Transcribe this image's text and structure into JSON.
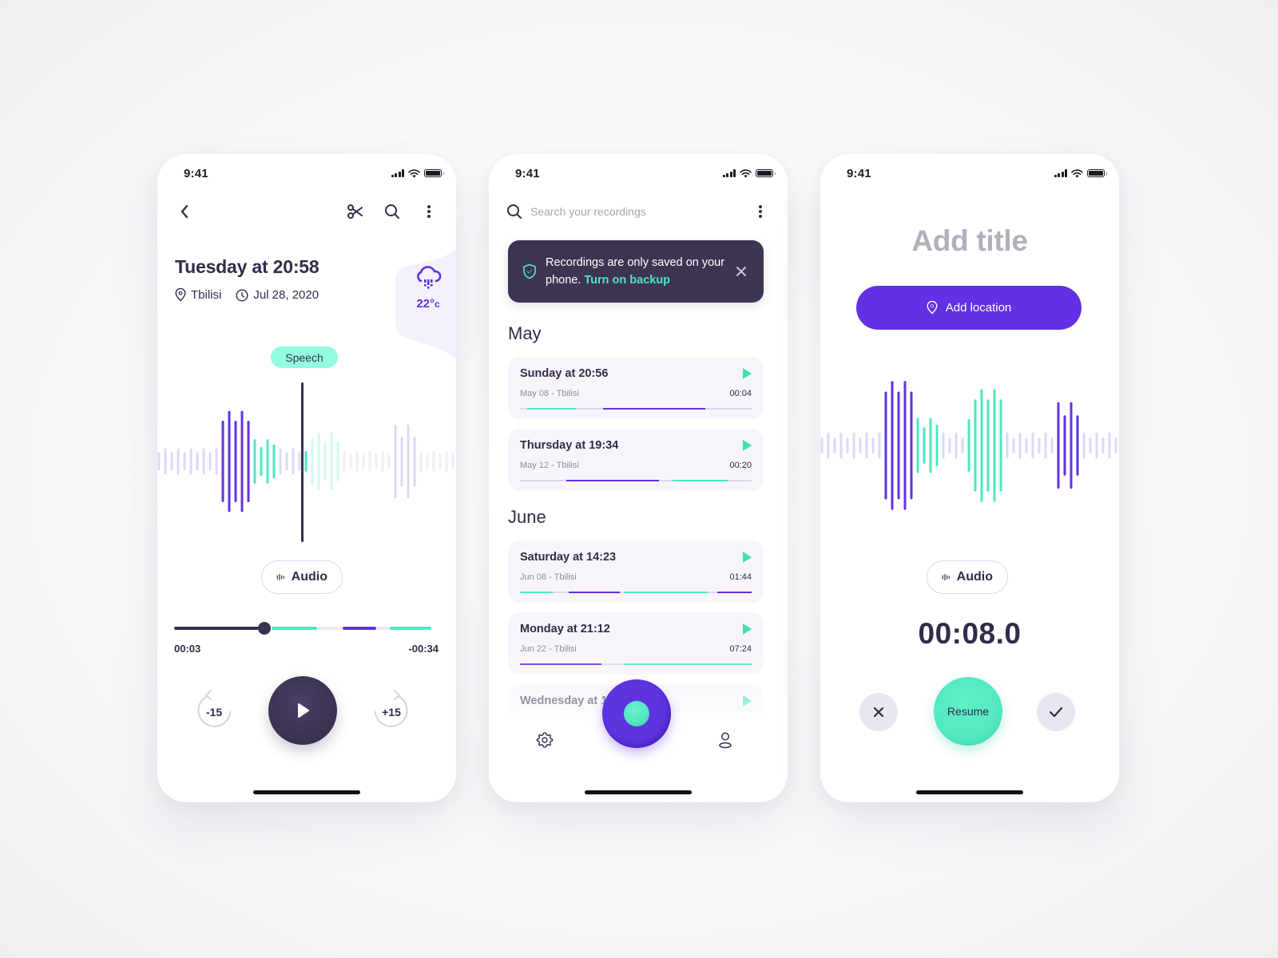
{
  "colors": {
    "purple": "#6231e3",
    "mint": "#4fe6c0",
    "dark": "#3b3150",
    "muted_purple": "#dcd8f4",
    "muted_mint": "#d6f9ef"
  },
  "status_bar": {
    "time": "9:41",
    "icons": [
      "cellular-signal-icon",
      "wifi-icon",
      "battery-icon"
    ]
  },
  "player": {
    "nav": {
      "back_icon": "chevron-left-icon",
      "actions": [
        "scissors-icon",
        "search-icon",
        "more-vertical-icon"
      ]
    },
    "title": "Tuesday at 20:58",
    "location": "Tbilisi",
    "date": "Jul 28, 2020",
    "weather": {
      "icon": "cloud-rain-icon",
      "temperature": "22°",
      "unit": "c"
    },
    "tag": "Speech",
    "waveform": {
      "bars": [
        {
          "h": 0.12,
          "c": "p"
        },
        {
          "h": 0.18,
          "c": "p"
        },
        {
          "h": 0.12,
          "c": "p"
        },
        {
          "h": 0.18,
          "c": "p"
        },
        {
          "h": 0.12,
          "c": "p"
        },
        {
          "h": 0.18,
          "c": "p"
        },
        {
          "h": 0.12,
          "c": "p"
        },
        {
          "h": 0.18,
          "c": "p"
        },
        {
          "h": 0.12,
          "c": "p"
        },
        {
          "h": 0.18,
          "c": "p"
        },
        {
          "h": 0.6,
          "c": "P"
        },
        {
          "h": 0.75,
          "c": "P"
        },
        {
          "h": 0.6,
          "c": "P"
        },
        {
          "h": 0.75,
          "c": "P"
        },
        {
          "h": 0.6,
          "c": "P"
        },
        {
          "h": 0.32,
          "c": "M"
        },
        {
          "h": 0.2,
          "c": "M"
        },
        {
          "h": 0.32,
          "c": "M"
        },
        {
          "h": 0.24,
          "c": "M"
        },
        {
          "h": 0.18,
          "c": "p"
        },
        {
          "h": 0.12,
          "c": "p"
        },
        {
          "h": 0.18,
          "c": "p"
        },
        {
          "h": 0.12,
          "c": "p"
        },
        {
          "h": 0.14,
          "c": "M"
        },
        {
          "h": 0.34,
          "c": "m"
        },
        {
          "h": 0.42,
          "c": "m"
        },
        {
          "h": 0.28,
          "c": "m"
        },
        {
          "h": 0.42,
          "c": "m"
        },
        {
          "h": 0.28,
          "c": "m"
        },
        {
          "h": 0.14,
          "c": "q"
        },
        {
          "h": 0.1,
          "c": "q"
        },
        {
          "h": 0.14,
          "c": "q"
        },
        {
          "h": 0.1,
          "c": "q"
        },
        {
          "h": 0.14,
          "c": "q"
        },
        {
          "h": 0.1,
          "c": "q"
        },
        {
          "h": 0.14,
          "c": "q"
        },
        {
          "h": 0.1,
          "c": "q"
        },
        {
          "h": 0.54,
          "c": "p"
        },
        {
          "h": 0.36,
          "c": "p"
        },
        {
          "h": 0.54,
          "c": "p"
        },
        {
          "h": 0.36,
          "c": "p"
        },
        {
          "h": 0.14,
          "c": "q"
        },
        {
          "h": 0.1,
          "c": "q"
        },
        {
          "h": 0.14,
          "c": "q"
        },
        {
          "h": 0.1,
          "c": "q"
        },
        {
          "h": 0.14,
          "c": "q"
        },
        {
          "h": 0.1,
          "c": "q"
        }
      ]
    },
    "view_toggle": {
      "icon": "audio-waveform-icon",
      "label": "Audio"
    },
    "progress": {
      "position_fraction": 0.35,
      "segments": [
        {
          "from": 0.0,
          "to": 0.35,
          "color": "dark"
        },
        {
          "from": 0.38,
          "to": 0.555,
          "color": "mint"
        },
        {
          "from": 0.555,
          "to": 0.655,
          "color": "track"
        },
        {
          "from": 0.655,
          "to": 0.785,
          "color": "purple"
        },
        {
          "from": 0.785,
          "to": 0.84,
          "color": "track"
        },
        {
          "from": 0.84,
          "to": 1.0,
          "color": "mint"
        }
      ]
    },
    "elapsed": "00:03",
    "remaining": "-00:34",
    "rewind_label": "-15",
    "forward_label": "+15",
    "play_icon": "play-icon"
  },
  "list": {
    "search_placeholder": "Search your recordings",
    "search_value": "",
    "banner": {
      "icon": "shield-check-icon",
      "text": "Recordings are only saved on your phone.",
      "link": "Turn on backup",
      "close_icon": "close-icon"
    },
    "groups": [
      {
        "month": "May",
        "items": [
          {
            "title": "Sunday at 20:56",
            "subtitle": "May 08 - Tbilisi",
            "duration": "00:04",
            "segments": [
              {
                "from": 0.03,
                "to": 0.24,
                "color": "mint"
              },
              {
                "from": 0.36,
                "to": 0.8,
                "color": "purple"
              }
            ]
          },
          {
            "title": "Thursday at 19:34",
            "subtitle": "May 12 - Tbilisi",
            "duration": "00:20",
            "segments": [
              {
                "from": 0.2,
                "to": 0.6,
                "color": "purple"
              },
              {
                "from": 0.66,
                "to": 0.9,
                "color": "mint"
              }
            ]
          }
        ]
      },
      {
        "month": "June",
        "items": [
          {
            "title": "Saturday at 14:23",
            "subtitle": "Jun 08 - Tbilisi",
            "duration": "01:44",
            "segments": [
              {
                "from": 0.0,
                "to": 0.14,
                "color": "mint"
              },
              {
                "from": 0.21,
                "to": 0.43,
                "color": "purple"
              },
              {
                "from": 0.45,
                "to": 0.81,
                "color": "mint"
              },
              {
                "from": 0.85,
                "to": 1.0,
                "color": "purple"
              }
            ]
          },
          {
            "title": "Monday at 21:12",
            "subtitle": "Jun 22 - Tbilisi",
            "duration": "07:24",
            "segments": [
              {
                "from": 0.0,
                "to": 0.35,
                "color": "purple"
              },
              {
                "from": 0.45,
                "to": 1.0,
                "color": "mint"
              }
            ]
          },
          {
            "title": "Wednesday at 1",
            "subtitle": "",
            "duration": "",
            "segments": []
          }
        ]
      }
    ],
    "bottom_nav": {
      "left_icon": "settings-gear-icon",
      "center": "record-button",
      "right_icon": "user-profile-icon"
    }
  },
  "record": {
    "title_placeholder": "Add title",
    "add_location_label": "Add location",
    "location_icon": "map-pin-icon",
    "waveform": {
      "bars": [
        {
          "h": 0.1,
          "c": "p"
        },
        {
          "h": 0.18,
          "c": "p"
        },
        {
          "h": 0.1,
          "c": "p"
        },
        {
          "h": 0.18,
          "c": "p"
        },
        {
          "h": 0.1,
          "c": "p"
        },
        {
          "h": 0.18,
          "c": "p"
        },
        {
          "h": 0.1,
          "c": "p"
        },
        {
          "h": 0.18,
          "c": "p"
        },
        {
          "h": 0.1,
          "c": "p"
        },
        {
          "h": 0.18,
          "c": "p"
        },
        {
          "h": 0.8,
          "c": "P"
        },
        {
          "h": 0.96,
          "c": "P"
        },
        {
          "h": 0.8,
          "c": "P"
        },
        {
          "h": 0.96,
          "c": "P"
        },
        {
          "h": 0.8,
          "c": "P"
        },
        {
          "h": 0.4,
          "c": "M"
        },
        {
          "h": 0.26,
          "c": "M"
        },
        {
          "h": 0.4,
          "c": "M"
        },
        {
          "h": 0.3,
          "c": "M"
        },
        {
          "h": 0.18,
          "c": "p"
        },
        {
          "h": 0.1,
          "c": "p"
        },
        {
          "h": 0.18,
          "c": "p"
        },
        {
          "h": 0.1,
          "c": "p"
        },
        {
          "h": 0.38,
          "c": "M"
        },
        {
          "h": 0.68,
          "c": "M"
        },
        {
          "h": 0.84,
          "c": "M"
        },
        {
          "h": 0.68,
          "c": "M"
        },
        {
          "h": 0.84,
          "c": "M"
        },
        {
          "h": 0.68,
          "c": "M"
        },
        {
          "h": 0.18,
          "c": "p"
        },
        {
          "h": 0.1,
          "c": "p"
        },
        {
          "h": 0.18,
          "c": "p"
        },
        {
          "h": 0.1,
          "c": "p"
        },
        {
          "h": 0.18,
          "c": "p"
        },
        {
          "h": 0.1,
          "c": "p"
        },
        {
          "h": 0.18,
          "c": "p"
        },
        {
          "h": 0.1,
          "c": "p"
        },
        {
          "h": 0.64,
          "c": "P"
        },
        {
          "h": 0.44,
          "c": "P"
        },
        {
          "h": 0.64,
          "c": "P"
        },
        {
          "h": 0.44,
          "c": "P"
        },
        {
          "h": 0.18,
          "c": "p"
        },
        {
          "h": 0.1,
          "c": "p"
        },
        {
          "h": 0.18,
          "c": "p"
        },
        {
          "h": 0.1,
          "c": "p"
        },
        {
          "h": 0.18,
          "c": "p"
        },
        {
          "h": 0.1,
          "c": "p"
        }
      ]
    },
    "view_toggle": {
      "icon": "audio-waveform-icon",
      "label": "Audio"
    },
    "timer": "00:08.0",
    "discard_icon": "close-icon",
    "resume_label": "Resume",
    "save_icon": "checkmark-icon"
  }
}
